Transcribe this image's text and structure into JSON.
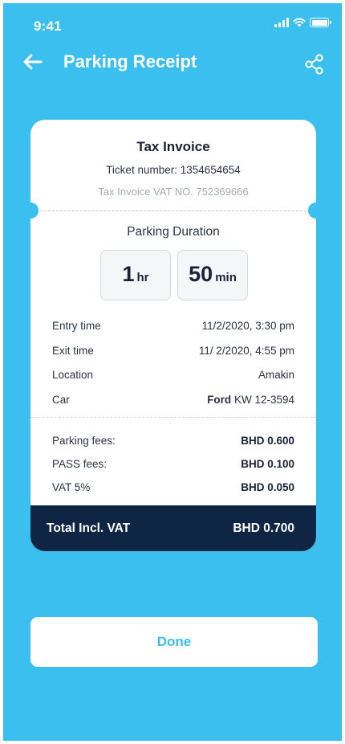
{
  "status_bar": {
    "time": "9:41"
  },
  "header": {
    "title": "Parking Receipt",
    "back_icon": "arrow-left-icon",
    "share_icon": "share-icon"
  },
  "receipt": {
    "title": "Tax Invoice",
    "ticket_number": "Ticket number: 1354654654",
    "vat_number": "Tax Invoice VAT NO. 752369666",
    "duration": {
      "label": "Parking Duration",
      "hours": "1",
      "hours_unit": "hr",
      "minutes": "50",
      "minutes_unit": "min"
    },
    "details": [
      {
        "label": "Entry time",
        "value": "11/2/2020, 3:30 pm"
      },
      {
        "label": "Exit time",
        "value": "11/ 2/2020, 4:55 pm"
      },
      {
        "label": "Location",
        "value": "Amakin"
      }
    ],
    "car": {
      "label": "Car",
      "make": "Ford",
      "plate": "KW 12-3594"
    },
    "fees": [
      {
        "label": "Parking fees:",
        "value": "BHD 0.600"
      },
      {
        "label": "PASS fees:",
        "value": "BHD 0.100"
      },
      {
        "label": "VAT 5%",
        "value": "BHD 0.050"
      }
    ],
    "total": {
      "label": "Total Incl. VAT",
      "value": "BHD 0.700"
    }
  },
  "done_button": {
    "label": "Done"
  },
  "colors": {
    "background": "#3ABFEF",
    "dark": "#0F2544",
    "card": "#FFFFFF"
  }
}
